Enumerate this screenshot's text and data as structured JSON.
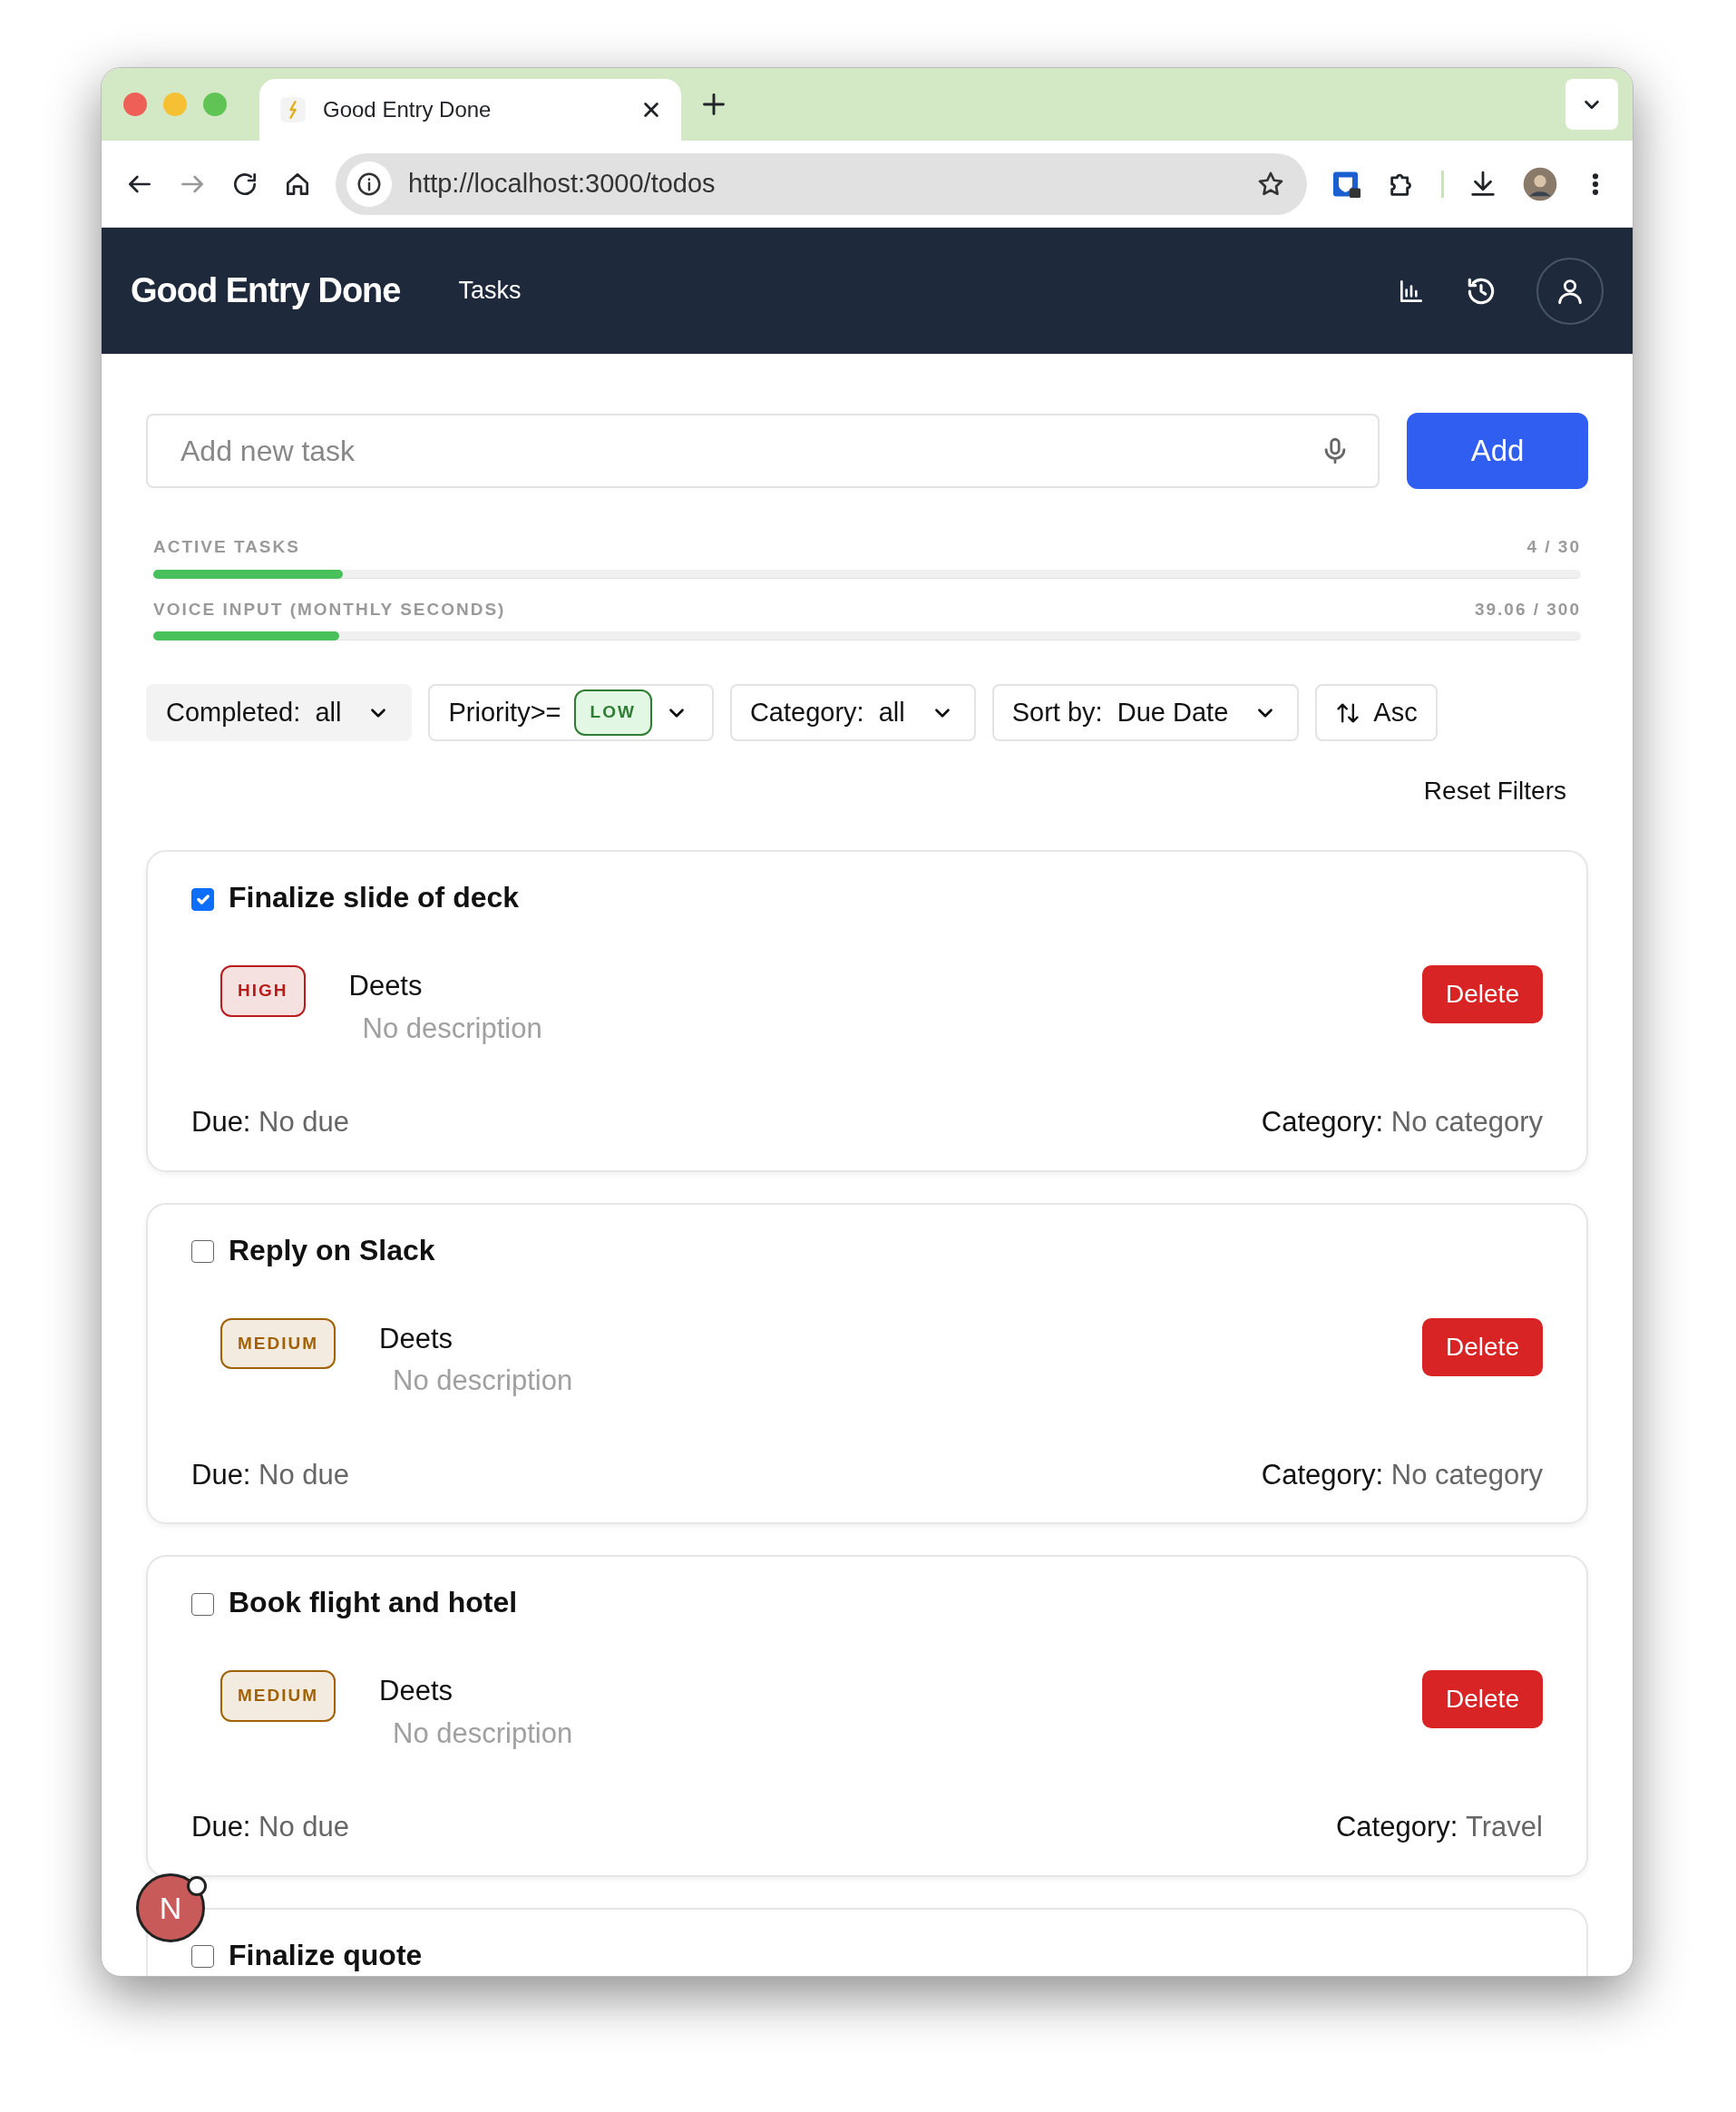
{
  "browser": {
    "tab_title": "Good Entry Done",
    "url": "http://localhost:3000/todos"
  },
  "app": {
    "brand": "Good Entry Done",
    "nav": [
      {
        "label": "Tasks"
      }
    ]
  },
  "new_task": {
    "placeholder": "Add new task",
    "button": "Add"
  },
  "meters": [
    {
      "label": "ACTIVE TASKS",
      "reading": "4 / 30",
      "level": 0.133
    },
    {
      "label": "VOICE INPUT (MONTHLY SECONDS)",
      "reading": "39.06 / 300",
      "level": 0.13
    }
  ],
  "filters": [
    {
      "kind": "select",
      "label": "Completed:",
      "value": "all",
      "highlighted": true
    },
    {
      "kind": "badge",
      "label": "Priority>=",
      "value": "LOW",
      "highlighted": false
    },
    {
      "kind": "select",
      "label": "Category:",
      "value": "all",
      "highlighted": false
    },
    {
      "kind": "select",
      "label": "Sort by:",
      "value": "Due Date",
      "highlighted": false
    },
    {
      "kind": "toggle",
      "label": "Asc",
      "highlighted": false
    }
  ],
  "reset_filters": "Reset Filters",
  "tasks": [
    {
      "title": "Finalize slide of deck",
      "completed": true,
      "priority": "HIGH",
      "color": "#b91c1c",
      "name": "Deets",
      "description": "No description",
      "due_label": "Due:",
      "due": "No due",
      "category_label": "Category:",
      "category": "No category",
      "delete": "Delete"
    },
    {
      "title": "Reply on Slack",
      "completed": false,
      "priority": "MEDIUM",
      "color": "#a16207",
      "name": "Deets",
      "description": "No description",
      "due_label": "Due:",
      "due": "No due",
      "category_label": "Category:",
      "category": "No category",
      "delete": "Delete"
    },
    {
      "title": "Book flight and hotel",
      "completed": false,
      "priority": "MEDIUM",
      "color": "#a16207",
      "name": "Deets",
      "description": "No description",
      "due_label": "Due:",
      "due": "No due",
      "category_label": "Category:",
      "category": "Travel",
      "delete": "Delete"
    },
    {
      "title": "Finalize quote",
      "completed": false
    }
  ],
  "dev_badge": "N"
}
